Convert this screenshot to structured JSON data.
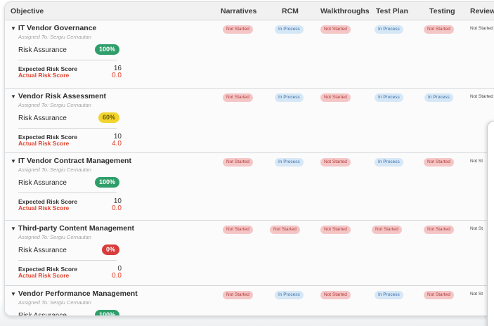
{
  "header": {
    "objective": "Objective",
    "narratives": "Narratives",
    "rcm": "RCM",
    "walkthroughs": "Walkthroughs",
    "test_plan": "Test Plan",
    "testing": "Testing",
    "review": "Review"
  },
  "labels": {
    "risk_assurance": "Risk Assurance",
    "expected_risk_score": "Expected Risk Score",
    "actual_risk_score": "Actual Risk Score"
  },
  "colors": {
    "not_started": "#f5c6c6",
    "in_process": "#d6e7f6",
    "ra_green": "#2f9e6a",
    "ra_yellow": "#f2d42f",
    "ra_red": "#d83c3c",
    "actual_red": "#e0432d"
  },
  "rows": [
    {
      "title": "IT Vendor Governance",
      "assigned": "Assigned To: Sergiu Cernautan",
      "risk_assurance": "100%",
      "expected": "16",
      "actual": "0.0",
      "narratives": "Not Started",
      "rcm": "In Process",
      "walkthroughs": "Not Started",
      "test_plan": "In Process",
      "testing": "Not Started",
      "review": "Not Started"
    },
    {
      "title": "Vendor Risk Assessment",
      "assigned": "Assigned To: Sergiu Cernautan",
      "risk_assurance": "60%",
      "expected": "10",
      "actual": "4.0",
      "narratives": "Not Started",
      "rcm": "In Process",
      "walkthroughs": "Not Started",
      "test_plan": "In Process",
      "testing": "In Process",
      "review": "Not Started"
    },
    {
      "title": "IT Vendor Contract Management",
      "assigned": "Assigned To: Sergiu Cernautan",
      "risk_assurance": "100%",
      "expected": "10",
      "actual": "0.0",
      "narratives": "Not Started",
      "rcm": "In Process",
      "walkthroughs": "Not Started",
      "test_plan": "In Process",
      "testing": "Not Started",
      "review": "Not St"
    },
    {
      "title": "Third-party Content Management",
      "assigned": "Assigned To: Sergiu Cernautan",
      "risk_assurance": "0%",
      "expected": "0",
      "actual": "0.0",
      "narratives": "Not Started",
      "rcm": "Not Started",
      "walkthroughs": "Not Started",
      "test_plan": "Not Started",
      "testing": "Not Started",
      "review": "Not St"
    },
    {
      "title": "Vendor Performance Management",
      "assigned": "Assigned To: Sergiu Cernautan",
      "risk_assurance": "100%",
      "narratives": "Not Started",
      "rcm": "In Process",
      "walkthroughs": "Not Started",
      "test_plan": "In Process",
      "testing": "Not Started",
      "review": "Not St"
    }
  ]
}
